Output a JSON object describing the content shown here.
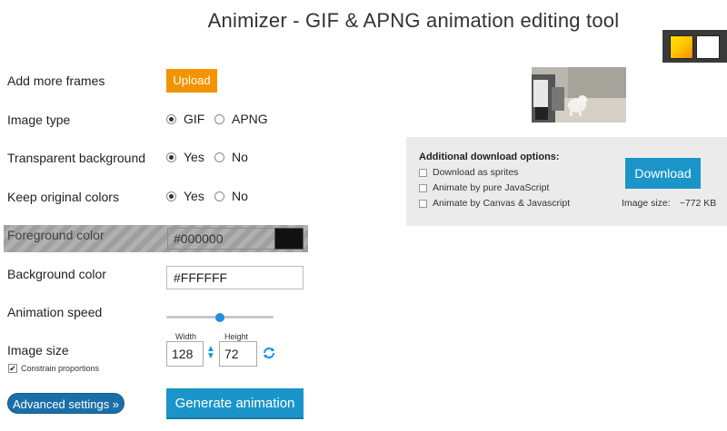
{
  "title": "Animizer - GIF & APNG animation editing tool",
  "swatches": [
    "gradient",
    "white"
  ],
  "colors": {
    "accent_orange": "#f29400",
    "accent_blue": "#1b95c9",
    "dark_blue": "#1b6fa8",
    "foreground": "#000000"
  },
  "settings": {
    "add_frames": {
      "label": "Add more frames",
      "button": "Upload"
    },
    "image_type": {
      "label": "Image type",
      "options": [
        "GIF",
        "APNG"
      ],
      "selected": "GIF"
    },
    "transparent_bg": {
      "label": "Transparent background",
      "options": [
        "Yes",
        "No"
      ],
      "selected": "Yes"
    },
    "keep_colors": {
      "label": "Keep original colors",
      "options": [
        "Yes",
        "No"
      ],
      "selected": "Yes"
    },
    "foreground": {
      "label": "Foreground color",
      "value": "#000000"
    },
    "background": {
      "label": "Background color",
      "value": "#FFFFFF"
    },
    "speed": {
      "label": "Animation speed",
      "level": 0.5
    },
    "size": {
      "label": "Image size",
      "width_label": "Width",
      "height_label": "Height",
      "width": "128",
      "height": "72",
      "constrain_label": "Constrain proportions",
      "constrain_checked": true
    }
  },
  "buttons": {
    "advanced": "Advanced settings »",
    "generate": "Generate animation"
  },
  "download": {
    "title": "Additional download options:",
    "options": [
      "Download as sprites",
      "Animate by pure JavaScript",
      "Animate by Canvas & Javascript"
    ],
    "button": "Download",
    "size_label": "Image size:",
    "size_value": "~772 KB"
  },
  "icons": {
    "link": "link-proportions-icon",
    "refresh": "refresh-icon"
  }
}
